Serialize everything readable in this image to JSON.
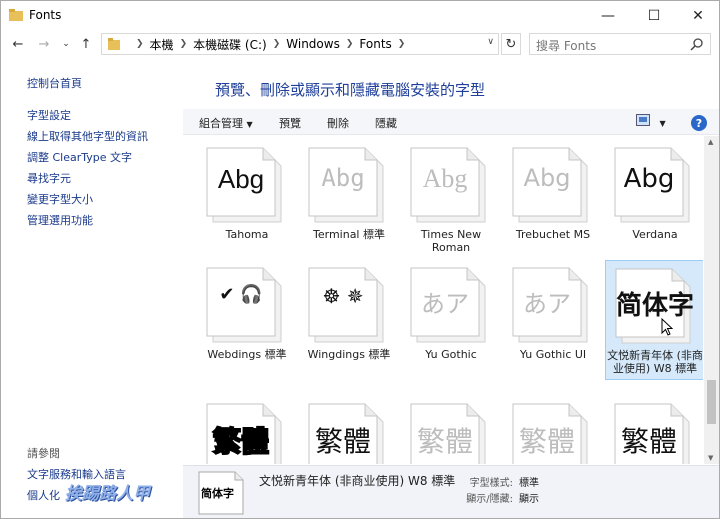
{
  "window": {
    "title": "Fonts"
  },
  "address": {
    "crumbs": [
      "本機",
      "本機磁碟 (C:)",
      "Windows",
      "Fonts"
    ],
    "search_placeholder": "搜尋 Fonts"
  },
  "sidebar": {
    "home": "控制台首頁",
    "links": [
      "字型設定",
      "線上取得其他字型的資訊",
      "調整 ClearType 文字",
      "尋找字元",
      "變更字型大小",
      "管理選用功能"
    ],
    "see_also": "請參閱",
    "see_links": [
      "文字服務和輸入語言",
      "個人化"
    ]
  },
  "heading": "預覽、刪除或顯示和隱藏電腦安裝的字型",
  "toolbar": {
    "organize": "組合管理",
    "preview": "預覽",
    "delete": "刪除",
    "hide": "隱藏",
    "help": "?"
  },
  "fonts": [
    {
      "name": "Tahoma",
      "sample": "Abg"
    },
    {
      "name": "Terminal 標準",
      "sample": "Abg"
    },
    {
      "name": "Times New Roman",
      "sample": "Abg"
    },
    {
      "name": "Trebuchet MS",
      "sample": "Abg"
    },
    {
      "name": "Verdana",
      "sample": "Abg"
    },
    {
      "name": "Webdings 標準",
      "sample": "✔ 🎧"
    },
    {
      "name": "Wingdings 標準",
      "sample": "☸ ✵"
    },
    {
      "name": "Yu Gothic",
      "sample": "あア"
    },
    {
      "name": "Yu Gothic UI",
      "sample": "あア"
    },
    {
      "name": "文悦新青年体 (非商业使用) W8 標準",
      "sample": "简体字"
    },
    {
      "name": "",
      "sample": "繁體"
    },
    {
      "name": "",
      "sample": "繁體"
    },
    {
      "name": "",
      "sample": "繁體"
    },
    {
      "name": "",
      "sample": "繁體"
    },
    {
      "name": "",
      "sample": "繁體"
    }
  ],
  "details": {
    "sample": "简体字",
    "name": "文悦新青年体 (非商业使用) W8 標準",
    "style_label": "字型樣式:",
    "style_value": "標準",
    "visibility_label": "顯示/隱藏:",
    "visibility_value": "顯示"
  },
  "watermark": "挨踢路人甲",
  "colors": {
    "accent": "#1e3f9a",
    "selection": "#d5e9fb"
  }
}
